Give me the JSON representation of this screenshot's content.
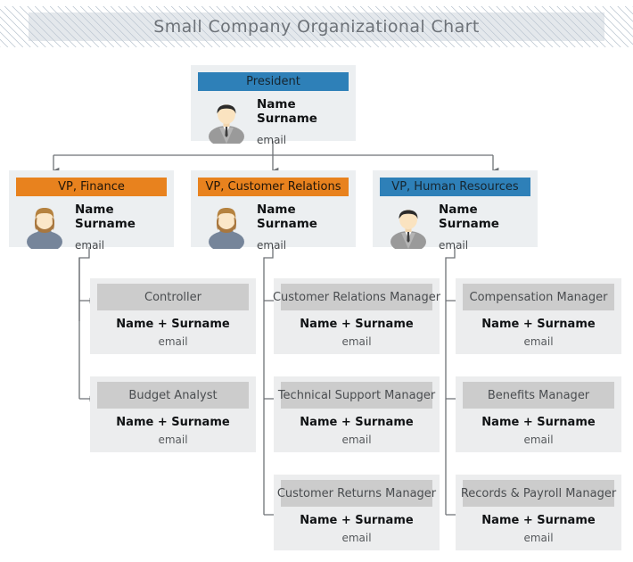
{
  "header": {
    "title": "Small Company Organizational Chart"
  },
  "colors": {
    "blue": "#2e80b8",
    "orange": "#e8821e",
    "gray_header": "#cccccc",
    "card_body": "#eceff1",
    "card_body_lvl3": "#ecedee",
    "connector": "#6e7276",
    "title_text": "#6d7278",
    "hatch_line": "#b9c4cf"
  },
  "labels": {
    "name_two_line_1": "Name",
    "name_two_line_2": "Surname",
    "name_single": "Name + Surname",
    "email": "email"
  },
  "nodes": {
    "president": {
      "title": "President",
      "name_line1": "Name",
      "name_line2": "Surname",
      "email": "email",
      "header_color": "blue",
      "avatar": "male-avatar-icon"
    },
    "vps": [
      {
        "title": "VP, Finance",
        "name_line1": "Name",
        "name_line2": "Surname",
        "email": "email",
        "header_color": "orange",
        "avatar": "female-avatar-icon"
      },
      {
        "title": "VP, Customer Relations",
        "name_line1": "Name",
        "name_line2": "Surname",
        "email": "email",
        "header_color": "orange",
        "avatar": "female-avatar-icon"
      },
      {
        "title": "VP, Human Resources",
        "name_line1": "Name",
        "name_line2": "Surname",
        "email": "email",
        "header_color": "blue",
        "avatar": "male-avatar-icon"
      }
    ],
    "managers": {
      "finance": [
        {
          "title": "Controller",
          "name": "Name + Surname",
          "email": "email"
        },
        {
          "title": "Budget Analyst",
          "name": "Name + Surname",
          "email": "email"
        }
      ],
      "customer_relations": [
        {
          "title": "Customer Relations Manager",
          "name": "Name + Surname",
          "email": "email"
        },
        {
          "title": "Technical Support Manager",
          "name": "Name + Surname",
          "email": "email"
        },
        {
          "title": "Customer Returns Manager",
          "name": "Name + Surname",
          "email": "email"
        }
      ],
      "human_resources": [
        {
          "title": "Compensation Manager",
          "name": "Name + Surname",
          "email": "email"
        },
        {
          "title": "Benefits Manager",
          "name": "Name + Surname",
          "email": "email"
        },
        {
          "title": "Records & Payroll Manager",
          "name": "Name + Surname",
          "email": "email"
        }
      ]
    }
  }
}
